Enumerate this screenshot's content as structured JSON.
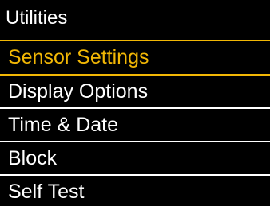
{
  "theme": {
    "background": "#000000",
    "text": "#ffffff",
    "accent": "#f2b705",
    "divider": "#ffffff"
  },
  "header": {
    "title": "Utilities"
  },
  "menu": {
    "items": [
      {
        "label": "Sensor Settings",
        "selected": true
      },
      {
        "label": "Display Options",
        "selected": false
      },
      {
        "label": "Time & Date",
        "selected": false
      },
      {
        "label": "Block",
        "selected": false
      },
      {
        "label": "Self Test",
        "selected": false
      }
    ]
  }
}
